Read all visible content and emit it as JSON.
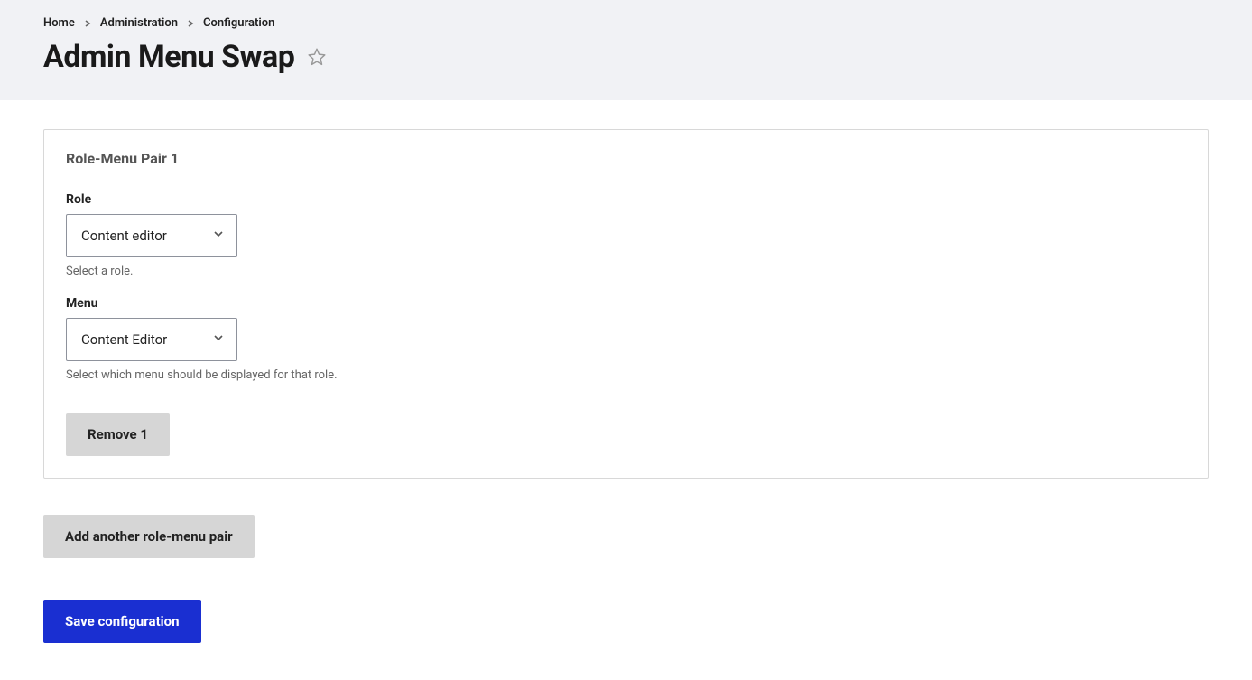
{
  "breadcrumb": {
    "items": [
      {
        "label": "Home"
      },
      {
        "label": "Administration"
      },
      {
        "label": "Configuration"
      }
    ]
  },
  "page": {
    "title": "Admin Menu Swap"
  },
  "fieldset": {
    "legend": "Role-Menu Pair 1",
    "role": {
      "label": "Role",
      "value": "Content editor",
      "description": "Select a role."
    },
    "menu": {
      "label": "Menu",
      "value": "Content Editor",
      "description": "Select which menu should be displayed for that role."
    },
    "remove_label": "Remove 1"
  },
  "actions": {
    "add_label": "Add another role-menu pair",
    "save_label": "Save configuration"
  }
}
